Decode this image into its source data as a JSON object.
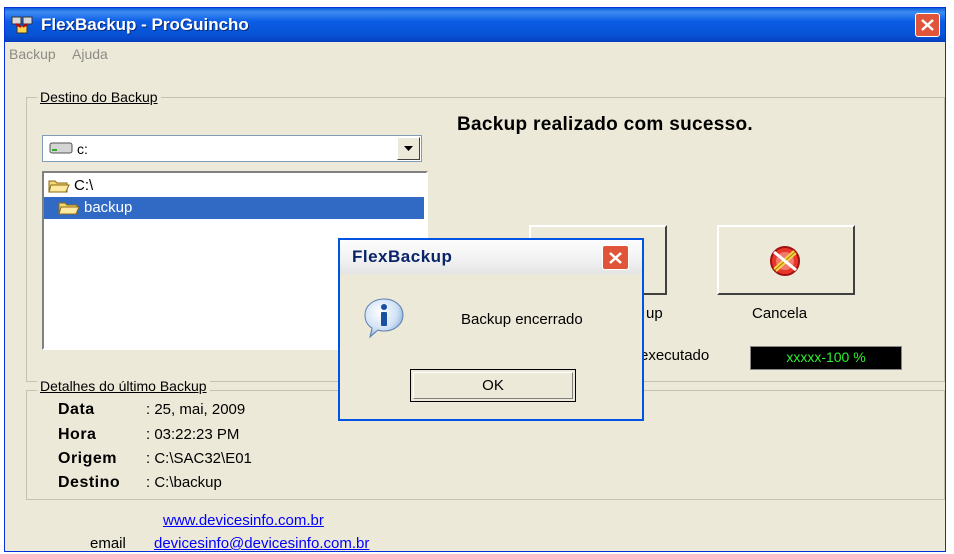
{
  "window": {
    "title": "FlexBackup - ProGuincho"
  },
  "menu": {
    "items": [
      "Backup",
      "Ajuda"
    ]
  },
  "destination": {
    "legend": "Destino do Backup",
    "drive_value": "c:",
    "folders": [
      "C:\\",
      "backup"
    ],
    "selected_folder": "backup"
  },
  "status": {
    "message": "Backup realizado com sucesso."
  },
  "buttons": {
    "backup_label_partial": "up",
    "cancel_label": "Cancela",
    "cancel_icon": "no-pencil-icon"
  },
  "progress": {
    "label_partial": "executado",
    "text": "xxxxx-100 %",
    "percent": 100
  },
  "details": {
    "legend": "Detalhes do último Backup",
    "rows": [
      {
        "label": "Data",
        "value": ": 25, mai, 2009"
      },
      {
        "label": "Hora",
        "value": ": 03:22:23 PM"
      },
      {
        "label": "Origem",
        "value": ": C:\\SAC32\\E01"
      },
      {
        "label": "Destino",
        "value": ": C:\\backup"
      }
    ]
  },
  "footer": {
    "website": "www.devicesinfo.com.br",
    "email_label": "email",
    "email": "devicesinfo@devicesinfo.com.br"
  },
  "dialog": {
    "title": "FlexBackup",
    "message": "Backup encerrado",
    "ok_label": "OK",
    "icon": "info-icon"
  },
  "colors": {
    "title_bar": "#0752d4",
    "selection": "#316ac5",
    "progress_text": "#2ef02e",
    "link": "#0000ff",
    "close_button": "#e0553a"
  }
}
